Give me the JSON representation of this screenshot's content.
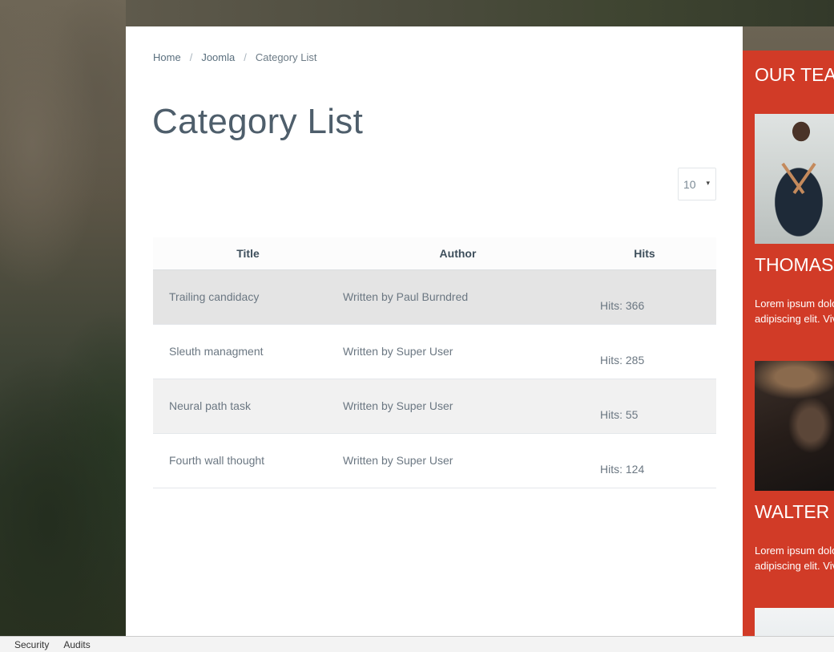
{
  "breadcrumb": [
    {
      "label": "Home"
    },
    {
      "label": "Joomla"
    },
    {
      "label": "Category List"
    }
  ],
  "breadcrumb_separator": "/",
  "page": {
    "title": "Category List"
  },
  "list_limit": {
    "value": "10",
    "arrow": "▾"
  },
  "table": {
    "headers": [
      "Title",
      "Author",
      "Hits"
    ],
    "rows": [
      {
        "title": "Trailing candidacy",
        "author": "Written by Paul Burndred",
        "hits": "Hits: 366"
      },
      {
        "title": "Sleuth managment",
        "author": "Written by Super User",
        "hits": "Hits: 285"
      },
      {
        "title": "Neural path task",
        "author": "Written by Super User",
        "hits": "Hits: 55"
      },
      {
        "title": "Fourth wall thought",
        "author": "Written by Super User",
        "hits": "Hits: 124"
      }
    ]
  },
  "team": {
    "heading": "OUR TEAM",
    "accent_color": "#d13b27",
    "members": [
      {
        "name": "THOMAS",
        "bio_line1": "Lorem ipsum dolor sit amet, consectetur",
        "bio_line2": "adipiscing elit. Vivamus"
      },
      {
        "name": "WALTER B",
        "bio_line1": "Lorem ipsum dolor sit amet, consectetur",
        "bio_line2": "adipiscing elit. Vivamus"
      }
    ]
  },
  "devtools": {
    "tabs": [
      "Security",
      "Audits"
    ]
  }
}
